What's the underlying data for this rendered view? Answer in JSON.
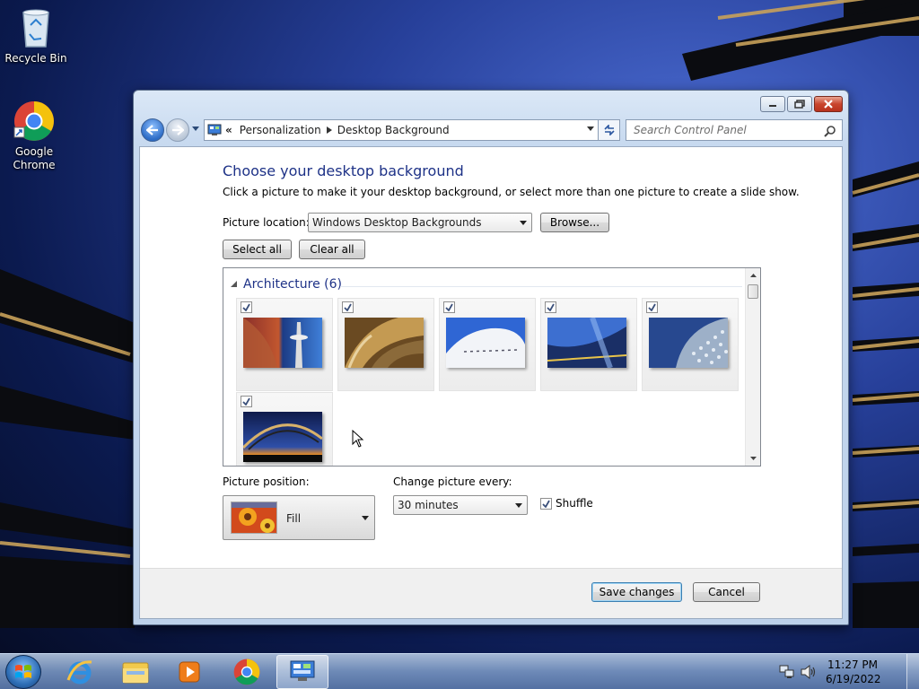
{
  "desktop": {
    "icons": [
      {
        "label": "Recycle Bin"
      },
      {
        "label": "Google Chrome"
      }
    ]
  },
  "window": {
    "breadcrumb": {
      "overflow": "«",
      "items": [
        "Personalization",
        "Desktop Background"
      ]
    },
    "search_placeholder": "Search Control Panel",
    "title": "Choose your desktop background",
    "subtitle": "Click a picture to make it your desktop background, or select more than one picture to create a slide show.",
    "picture_location": {
      "label": "Picture location:",
      "value": "Windows Desktop Backgrounds",
      "browse": "Browse..."
    },
    "select_all": "Select all",
    "clear_all": "Clear all",
    "group": {
      "name": "Architecture (6)",
      "pictures": [
        {
          "checked": true,
          "icon": "space-needle-thumbnail"
        },
        {
          "checked": true,
          "icon": "curved-metal-thumbnail"
        },
        {
          "checked": true,
          "icon": "white-building-thumbnail"
        },
        {
          "checked": true,
          "icon": "blue-glass-thumbnail"
        },
        {
          "checked": true,
          "icon": "dotted-facade-thumbnail"
        },
        {
          "checked": true,
          "icon": "bridge-sunset-thumbnail"
        }
      ]
    },
    "picture_position": {
      "label": "Picture position:",
      "value": "Fill"
    },
    "change_every": {
      "label": "Change picture every:",
      "value": "30 minutes"
    },
    "shuffle": {
      "label": "Shuffle",
      "checked": true
    },
    "save_label": "Save changes",
    "cancel_label": "Cancel"
  },
  "taskbar": {
    "apps": [
      "internet-explorer-icon",
      "file-explorer-icon",
      "media-player-icon",
      "chrome-icon",
      "control-panel-icon"
    ],
    "time": "11:27 PM",
    "date": "6/19/2022"
  }
}
